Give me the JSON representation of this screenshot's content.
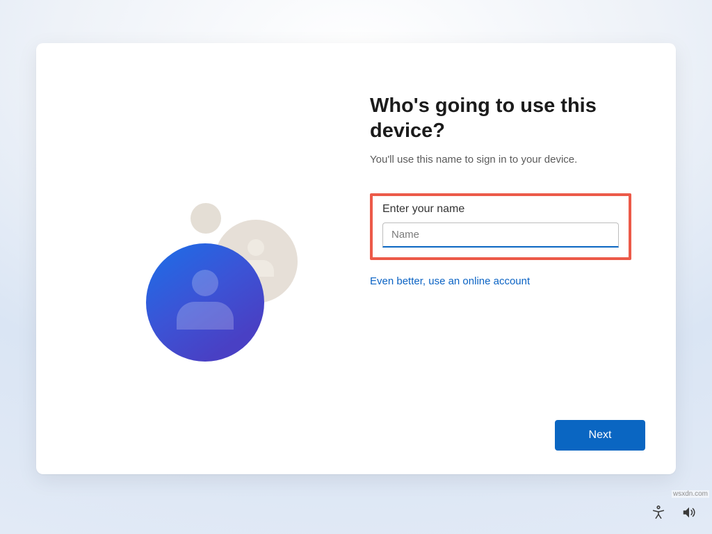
{
  "heading": "Who's going to use this device?",
  "subheading": "You'll use this name to sign in to your device.",
  "form": {
    "label": "Enter your name",
    "placeholder": "Name",
    "value": ""
  },
  "online_link": "Even better, use an online account",
  "buttons": {
    "next": "Next"
  },
  "watermark": "wsxdn.com",
  "colors": {
    "highlight": "#ec5a49",
    "primary": "#0a66c2",
    "link": "#0b63c4"
  },
  "icons": {
    "accessibility": "accessibility-icon",
    "volume": "volume-icon",
    "user": "user-avatar-icon"
  }
}
